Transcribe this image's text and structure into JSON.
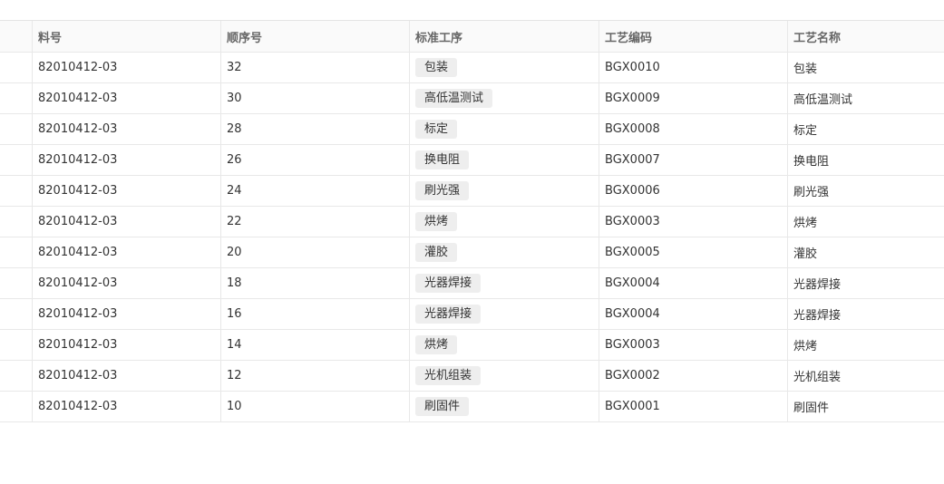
{
  "table": {
    "headers": [
      "",
      "料号",
      "顺序号",
      "标准工序",
      "工艺编码",
      "工艺名称"
    ],
    "rows": [
      {
        "part_no": "82010412-03",
        "seq": "32",
        "std_process": "包装",
        "code": "BGX0010",
        "name": "包装"
      },
      {
        "part_no": "82010412-03",
        "seq": "30",
        "std_process": "高低温测试",
        "code": "BGX0009",
        "name": "高低温测试"
      },
      {
        "part_no": "82010412-03",
        "seq": "28",
        "std_process": "标定",
        "code": "BGX0008",
        "name": "标定"
      },
      {
        "part_no": "82010412-03",
        "seq": "26",
        "std_process": "换电阻",
        "code": "BGX0007",
        "name": "换电阻"
      },
      {
        "part_no": "82010412-03",
        "seq": "24",
        "std_process": "刷光强",
        "code": "BGX0006",
        "name": "刷光强"
      },
      {
        "part_no": "82010412-03",
        "seq": "22",
        "std_process": "烘烤",
        "code": "BGX0003",
        "name": "烘烤"
      },
      {
        "part_no": "82010412-03",
        "seq": "20",
        "std_process": "灌胶",
        "code": "BGX0005",
        "name": "灌胶"
      },
      {
        "part_no": "82010412-03",
        "seq": "18",
        "std_process": "光器焊接",
        "code": "BGX0004",
        "name": "光器焊接"
      },
      {
        "part_no": "82010412-03",
        "seq": "16",
        "std_process": "光器焊接",
        "code": "BGX0004",
        "name": "光器焊接"
      },
      {
        "part_no": "82010412-03",
        "seq": "14",
        "std_process": "烘烤",
        "code": "BGX0003",
        "name": "烘烤"
      },
      {
        "part_no": "82010412-03",
        "seq": "12",
        "std_process": "光机组装",
        "code": "BGX0002",
        "name": "光机组装"
      },
      {
        "part_no": "82010412-03",
        "seq": "10",
        "std_process": "刷固件",
        "code": "BGX0001",
        "name": "刷固件"
      }
    ]
  }
}
